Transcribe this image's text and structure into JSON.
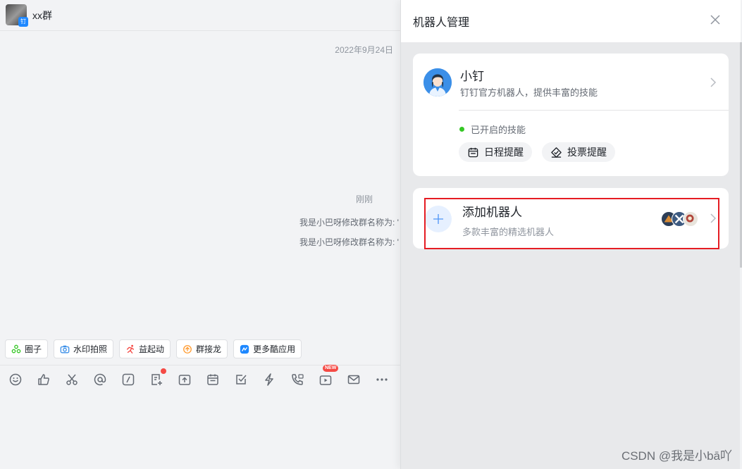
{
  "chat": {
    "title": "xx群",
    "badge": "钉",
    "date": "2022年9月24日",
    "time": "刚刚",
    "messages": [
      "我是小巴呀修改群名称为: '",
      "我是小巴呀修改群名称为: '"
    ]
  },
  "apps": [
    {
      "label": "圈子",
      "icon": "circle-icon",
      "color": "#34c724"
    },
    {
      "label": "水印拍照",
      "icon": "camera-icon",
      "color": "#3b8fe8"
    },
    {
      "label": "益起动",
      "icon": "runner-icon",
      "color": "#f54a45"
    },
    {
      "label": "群接龙",
      "icon": "relay-icon",
      "color": "#ff9a2e"
    },
    {
      "label": "更多酷应用",
      "icon": "more-apps-icon",
      "color": "#1e88ff"
    }
  ],
  "toolbar": {
    "icons": [
      "emoji-icon",
      "thumb-up-icon",
      "scissors-icon",
      "at-icon",
      "slash-command-icon",
      "doc-add-icon",
      "upload-icon",
      "calendar-icon",
      "todo-icon",
      "flash-icon",
      "phone-icon",
      "live-icon",
      "mail-icon",
      "more-icon"
    ],
    "new_label": "NEW"
  },
  "panel": {
    "title": "机器人管理",
    "bot": {
      "name": "小钉",
      "desc": "钉钉官方机器人，提供丰富的技能",
      "skills_label": "已开启的技能",
      "skills": [
        "日程提醒",
        "投票提醒"
      ]
    },
    "add": {
      "title": "添加机器人",
      "desc": "多款丰富的精选机器人"
    }
  },
  "watermark": "CSDN @我是小bā吖",
  "colors": {
    "accent": "#1e88ff",
    "highlight": "#e51c23",
    "green": "#34c724"
  }
}
